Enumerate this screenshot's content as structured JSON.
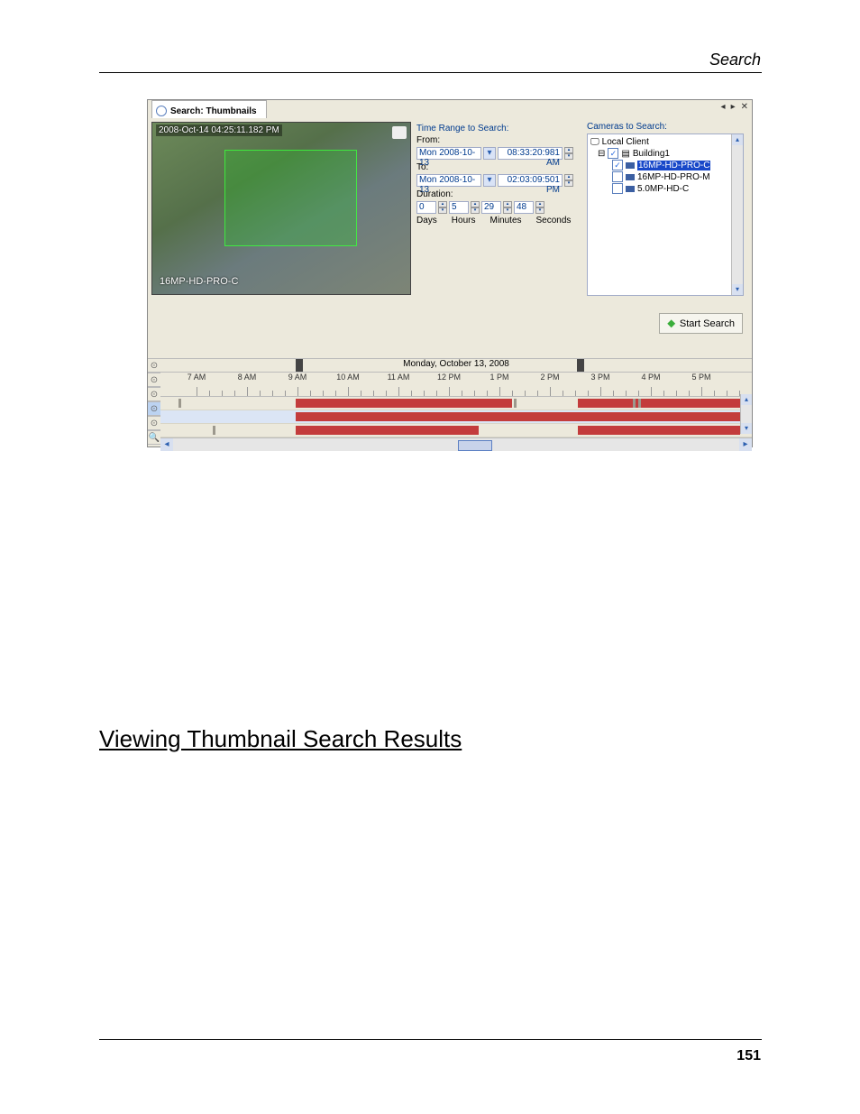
{
  "page": {
    "header_title": "Search",
    "section_heading": "Viewing Thumbnail Search Results",
    "page_number": "151"
  },
  "app": {
    "tab_title": "Search: Thumbnails",
    "video_timestamp": "2008-Oct-14 04:25:11.182 PM",
    "camera_name": "16MP-HD-PRO-C",
    "time_range_title": "Time Range to Search:",
    "from_label": "From:",
    "from_date": "Mon 2008-10-13",
    "from_time": "08:33:20:981  AM",
    "to_label": "To:",
    "to_date": "Mon 2008-10-13",
    "to_time": "02:03:09:501  PM",
    "duration_label": "Duration:",
    "duration": {
      "days": "0",
      "hours": "5",
      "minutes": "29",
      "seconds": "48"
    },
    "duration_units": {
      "days": "Days",
      "hours": "Hours",
      "minutes": "Minutes",
      "seconds": "Seconds"
    },
    "cameras_title": "Cameras to Search:",
    "tree": {
      "root": "Local Client",
      "site": "Building1",
      "items": [
        {
          "label": "16MP-HD-PRO-C",
          "checked": true,
          "highlight": true
        },
        {
          "label": "16MP-HD-PRO-M",
          "checked": false,
          "highlight": false
        },
        {
          "label": "5.0MP-HD-C",
          "checked": false,
          "highlight": false
        }
      ]
    },
    "start_search": "Start Search",
    "timeline": {
      "date_header": "Monday, October 13, 2008",
      "hours": [
        "7 AM",
        "8 AM",
        "9 AM",
        "10 AM",
        "11 AM",
        "12 PM",
        "1 PM",
        "2 PM",
        "3 PM",
        "4 PM",
        "5 PM"
      ]
    }
  }
}
